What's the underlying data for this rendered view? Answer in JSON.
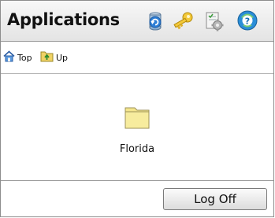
{
  "header": {
    "title": "Applications",
    "icons": [
      "refresh-icon",
      "key-icon",
      "settings-icon",
      "help-icon"
    ]
  },
  "nav": {
    "top_label": "Top",
    "up_label": "Up"
  },
  "folders": [
    {
      "label": "Florida",
      "icon": "folder-icon"
    }
  ],
  "footer": {
    "logoff_label": "Log Off"
  },
  "colors": {
    "folder_fill": "#f4e58d",
    "header_bg": "#ececec",
    "border": "#8d8d8d"
  }
}
